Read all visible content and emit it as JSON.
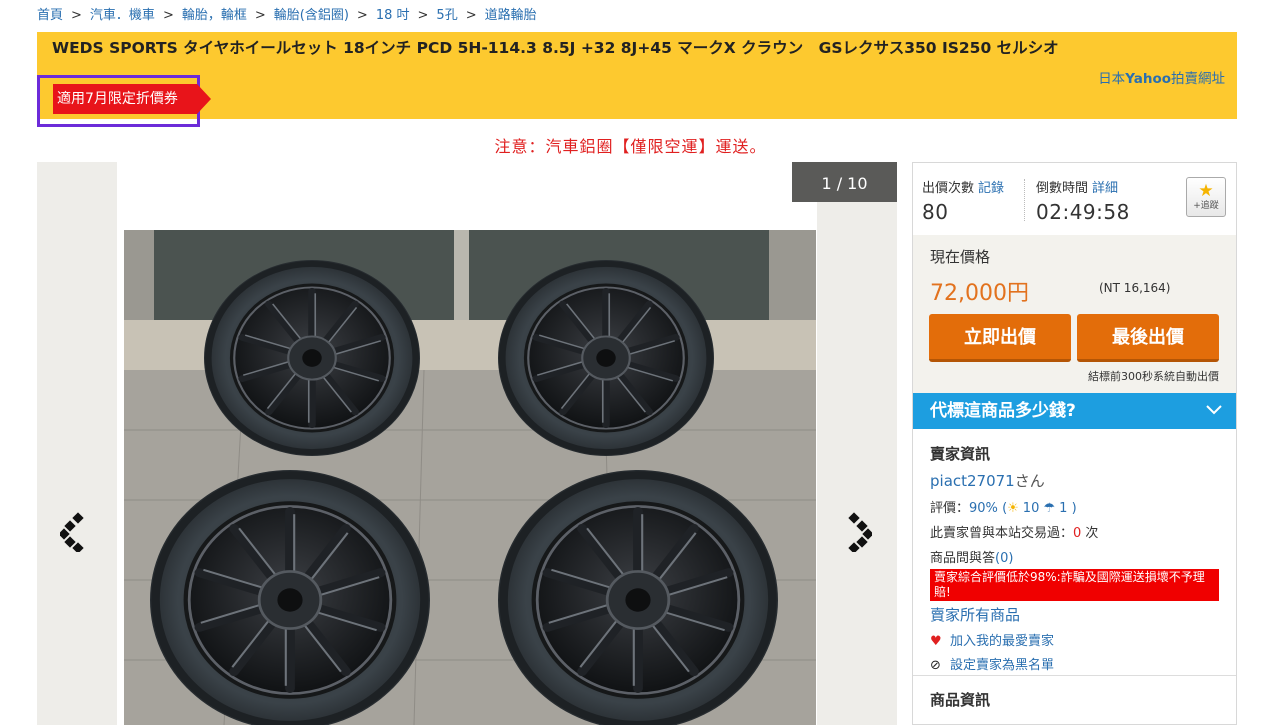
{
  "breadcrumb": {
    "items": [
      "首頁",
      "汽車．機車",
      "輪胎，輪框",
      "輪胎(含鋁圈)",
      "18 吋",
      "5孔",
      "道路輪胎"
    ]
  },
  "product": {
    "title": "WEDS SPORTS タイヤホイールセット 18インチ PCD 5H-114.3 8.5J +32 8J+45 マークX クラウン　GSレクサス350 IS250 セルシオ",
    "coupon": "適用7月限定折價券",
    "yahoo_link_prefix": "日本",
    "yahoo_link_brand": "Yahoo",
    "yahoo_link_suffix": "拍賣網址"
  },
  "notice": "注意：汽車鋁圈【僅限空運】運送。",
  "gallery": {
    "counter": "1 / 10"
  },
  "stats": {
    "bids_label": "出價次數",
    "bids_link": "記錄",
    "bids_value": "80",
    "time_label": "倒數時間",
    "time_link": "詳細",
    "time_value": "02:49:58",
    "follow_label": "+追蹤"
  },
  "price": {
    "label": "現在價格",
    "value": "72,000円",
    "nt": "(NT 16,164)",
    "bid_now": "立即出價",
    "bid_last": "最後出價",
    "auto_note": "結標前300秒系統自動出價"
  },
  "cost_bar": "代標這商品多少錢?",
  "seller": {
    "title": "賣家資訊",
    "name": "piact27071",
    "name_suffix": "さん",
    "rating_label": "評價：",
    "rating_pct": "90%",
    "rating_good": "10",
    "rating_bad": "1",
    "trade_label": "此賣家曾與本站交易過：",
    "trade_count": "0",
    "trade_unit": " 次",
    "qa_label": "商品問與答",
    "qa_count": "(0)",
    "warning": "賣家綜合評價低於98%:詐騙及國際運送損壞不予理賠!",
    "all_items": "賣家所有商品",
    "add_fav": "加入我的最愛賣家",
    "blacklist": "設定賣家為黑名單"
  },
  "product_info_title": "商品資訊",
  "colors": {
    "title_bg": "#fdc92f",
    "accent_orange": "#e36d0a",
    "link_blue": "#2a6fb0",
    "alert_red": "#e02020",
    "cost_bar_bg": "#1d9ee0"
  }
}
